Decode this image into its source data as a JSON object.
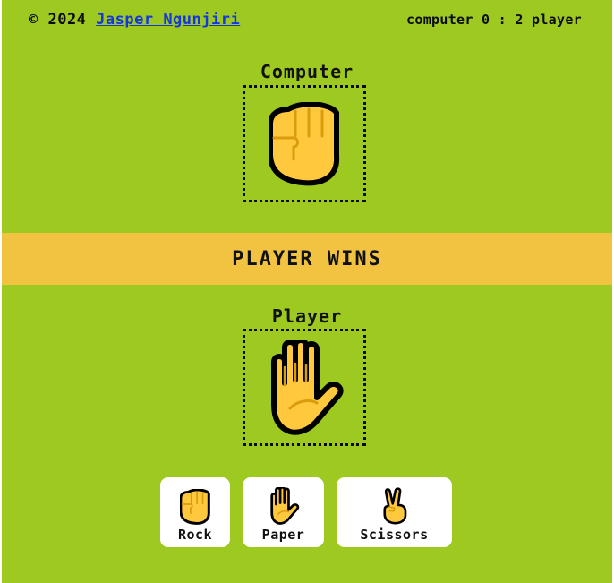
{
  "footer": {
    "copyright_prefix": "© 2024",
    "author_name": "Jasper Ngunjiri"
  },
  "scoreboard": {
    "text": "computer 0 : 2 player",
    "computer_score": 0,
    "player_score": 2
  },
  "computer": {
    "label": "Computer",
    "choice": "rock",
    "icon": "fist-icon"
  },
  "result": {
    "text": "PLAYER WINS"
  },
  "player": {
    "label": "Player",
    "choice": "paper",
    "icon": "raised-hand-icon"
  },
  "choices": [
    {
      "label": "Rock",
      "icon": "fist-icon"
    },
    {
      "label": "Paper",
      "icon": "raised-hand-icon"
    },
    {
      "label": "Scissors",
      "icon": "victory-hand-icon"
    }
  ],
  "colors": {
    "background": "#9ec920",
    "banner": "#f1c341",
    "hand_fill": "#ffc83d",
    "hand_outline": "#000000",
    "link": "#1436e0"
  }
}
